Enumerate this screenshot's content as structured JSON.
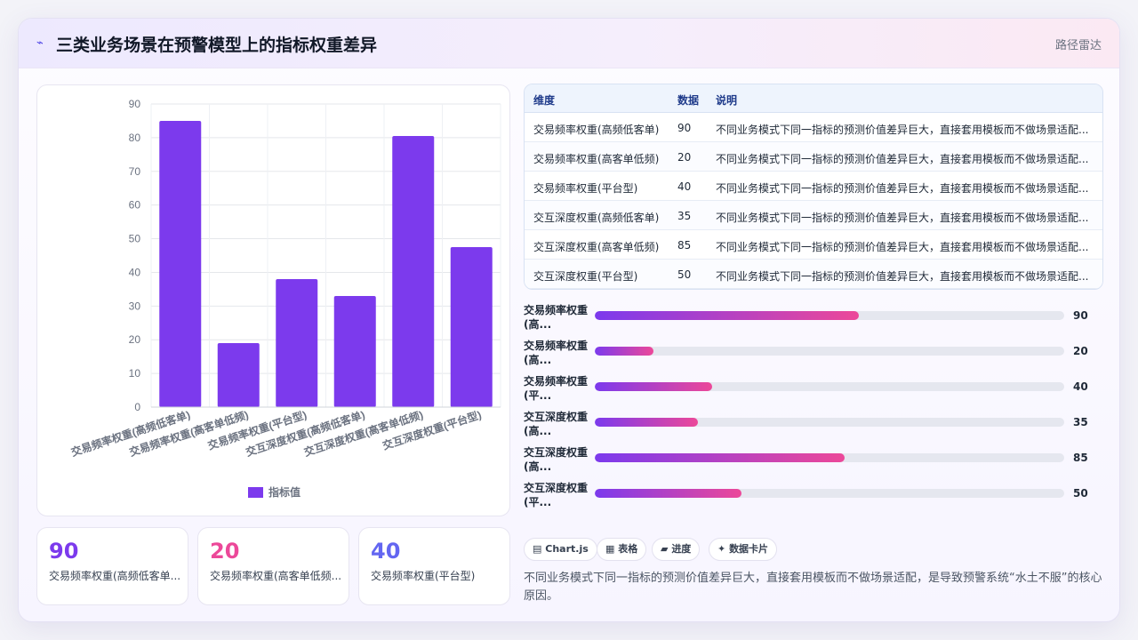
{
  "header": {
    "logo_icon": "radar-pulse-icon",
    "logo_glyph": "⌁",
    "title": "三类业务场景在预警模型上的指标权重差异",
    "tag": "路径雷达"
  },
  "chart_data": {
    "type": "bar",
    "categories": [
      "交易频率权重(高频低客单)",
      "交易频率权重(高客单低频)",
      "交易频率权重(平台型)",
      "交互深度权重(高频低客单)",
      "交互深度权重(高客单低频)",
      "交互深度权重(平台型)"
    ],
    "series": [
      {
        "name": "指标值",
        "values": [
          85,
          19,
          38,
          33,
          80.5,
          47.5
        ]
      }
    ],
    "ylim": [
      0,
      90
    ],
    "yticks": [
      0,
      10,
      20,
      30,
      40,
      50,
      60,
      70,
      80,
      90
    ],
    "grid": true,
    "legend_position": "bottom",
    "bar_color": "#7c3aed"
  },
  "table": {
    "headers": [
      "维度",
      "数据",
      "说明"
    ],
    "rows": [
      [
        "交易频率权重(高频低客单)",
        "90",
        "不同业务模式下同一指标的预测价值差异巨大，直接套用模板而不做场景适配..."
      ],
      [
        "交易频率权重(高客单低频)",
        "20",
        "不同业务模式下同一指标的预测价值差异巨大，直接套用模板而不做场景适配..."
      ],
      [
        "交易频率权重(平台型)",
        "40",
        "不同业务模式下同一指标的预测价值差异巨大，直接套用模板而不做场景适配..."
      ],
      [
        "交互深度权重(高频低客单)",
        "35",
        "不同业务模式下同一指标的预测价值差异巨大，直接套用模板而不做场景适配..."
      ],
      [
        "交互深度权重(高客单低频)",
        "85",
        "不同业务模式下同一指标的预测价值差异巨大，直接套用模板而不做场景适配..."
      ],
      [
        "交互深度权重(平台型)",
        "50",
        "不同业务模式下同一指标的预测价值差异巨大，直接套用模板而不做场景适配..."
      ]
    ]
  },
  "progress": {
    "max": 160,
    "items": [
      {
        "label_line1": "交易频率权重",
        "label_line2": "(高...",
        "value": 90
      },
      {
        "label_line1": "交易频率权重",
        "label_line2": "(高...",
        "value": 20
      },
      {
        "label_line1": "交易频率权重",
        "label_line2": "(平...",
        "value": 40
      },
      {
        "label_line1": "交互深度权重",
        "label_line2": "(高...",
        "value": 35
      },
      {
        "label_line1": "交互深度权重",
        "label_line2": "(高...",
        "value": 85
      },
      {
        "label_line1": "交互深度权重",
        "label_line2": "(平...",
        "value": 50
      }
    ]
  },
  "stats": [
    {
      "value": "90",
      "label": "交易频率权重(高频低客单...",
      "color": "#7c3aed"
    },
    {
      "value": "20",
      "label": "交易频率权重(高客单低频...",
      "color": "#ec4899"
    },
    {
      "value": "40",
      "label": "交易频率权重(平台型)",
      "color": "#6366f1"
    }
  ],
  "chips": [
    {
      "icon": "chart-icon",
      "glyph": "▤",
      "label": "Chart.js"
    },
    {
      "icon": "table-icon",
      "glyph": "▦",
      "label": "表格"
    },
    {
      "icon": "progress-icon",
      "glyph": "▰",
      "label": "进度"
    },
    {
      "icon": "sparkle-icon",
      "glyph": "✦",
      "label": "数据卡片"
    }
  ],
  "summary": "不同业务模式下同一指标的预测价值差异巨大，直接套用模板而不做场景适配，是导致预警系统“水土不服”的核心原因。"
}
